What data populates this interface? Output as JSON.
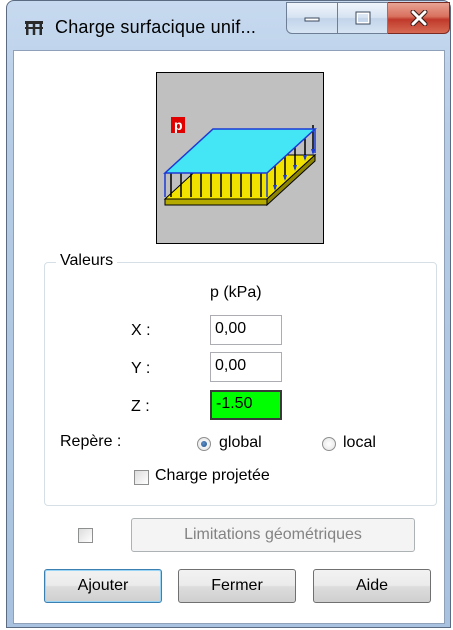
{
  "window": {
    "title": "Charge surfacique unif...",
    "icon": "frame-icon",
    "caption_buttons": [
      "minimize-icon",
      "maximize-icon",
      "close-icon"
    ]
  },
  "illustration": {
    "label": "p",
    "colors": {
      "background": "#c0c0c0",
      "plate": "#44e5f5",
      "base": "#f2e200",
      "label_bg": "#e00000"
    }
  },
  "values_group": {
    "title": "Valeurs",
    "column_header": "p  (kPa)",
    "rows": [
      {
        "label": "X :",
        "value": "0,00"
      },
      {
        "label": "Y :",
        "value": "0,00"
      },
      {
        "label": "Z :",
        "value": "-1.50"
      }
    ],
    "repere_label": "Repère :",
    "radio_global": "global",
    "radio_local": "local",
    "selected_repere": "global",
    "projected_label": "Charge projetée",
    "projected_checked": false
  },
  "limitations": {
    "checked": false,
    "button_label": "Limitations géométriques"
  },
  "buttons": {
    "add": "Ajouter",
    "close": "Fermer",
    "help": "Aide"
  },
  "colors": {
    "active_field": "#00ff00"
  }
}
